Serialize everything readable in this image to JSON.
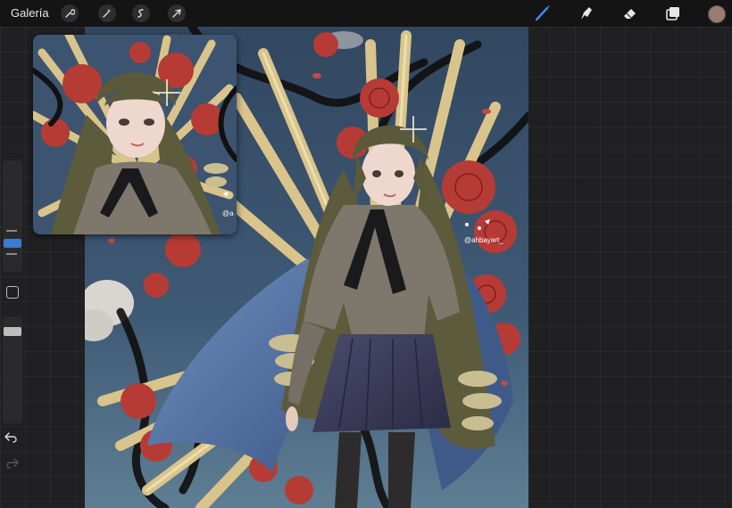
{
  "topbar": {
    "gallery_label": "Galería",
    "left_tools": [
      "wrench-icon",
      "magic-wand-icon",
      "selection-icon",
      "transform-arrow-icon"
    ],
    "right_tools": [
      "brush-icon",
      "smudge-icon",
      "eraser-icon",
      "layers-icon"
    ],
    "active_tool": "brush-icon",
    "current_color": "#9b7a70"
  },
  "canvas": {
    "artwork_watermark": "@ahbayart_",
    "palette": {
      "sky": "#3b4f66",
      "gold": "#d8c58a",
      "rose": "#b83a33",
      "skirt": "#3a3a5a",
      "sweater": "#7d776c",
      "hair": "#5e5d3e",
      "cape": "#5a7bab"
    }
  },
  "reference_window": {
    "watermark": "@a"
  },
  "sidebar": {
    "brush_size_level": 0.28,
    "opacity_level": 0.1
  }
}
